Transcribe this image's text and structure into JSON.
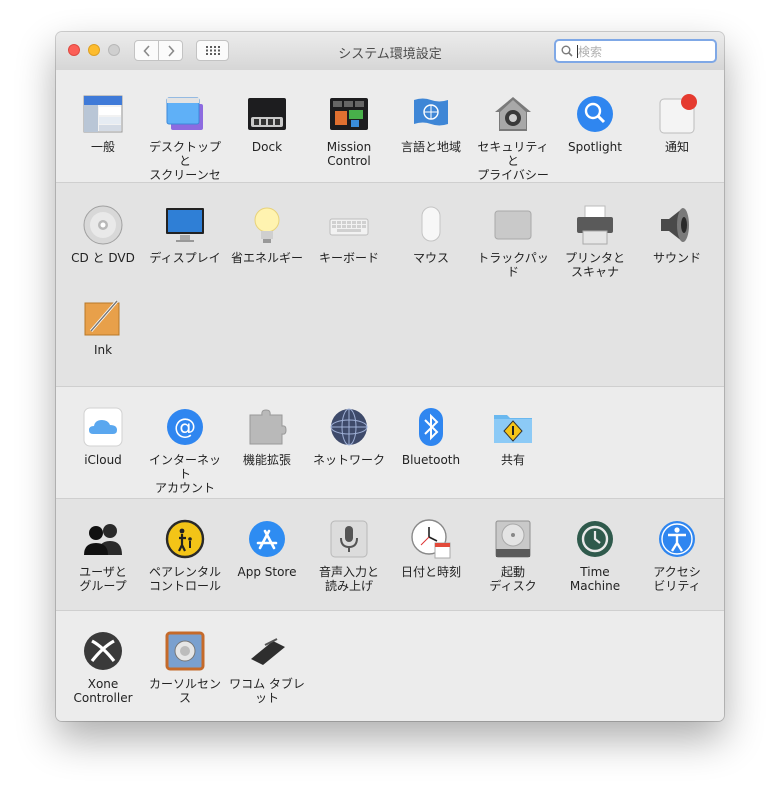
{
  "window": {
    "title": "システム環境設定"
  },
  "search": {
    "placeholder": "検索"
  },
  "sections": [
    {
      "items": [
        {
          "id": "general",
          "label": "一般"
        },
        {
          "id": "desktop",
          "label": "デスクトップと\nスクリーンセーバ"
        },
        {
          "id": "dock",
          "label": "Dock"
        },
        {
          "id": "mission",
          "label": "Mission\nControl"
        },
        {
          "id": "language",
          "label": "言語と地域"
        },
        {
          "id": "security",
          "label": "セキュリティと\nプライバシー"
        },
        {
          "id": "spotlight",
          "label": "Spotlight"
        },
        {
          "id": "notifications",
          "label": "通知"
        }
      ]
    },
    {
      "items": [
        {
          "id": "cddvd",
          "label": "CD と DVD"
        },
        {
          "id": "display",
          "label": "ディスプレイ"
        },
        {
          "id": "energy",
          "label": "省エネルギー"
        },
        {
          "id": "keyboard",
          "label": "キーボード"
        },
        {
          "id": "mouse",
          "label": "マウス"
        },
        {
          "id": "trackpad",
          "label": "トラックパッド"
        },
        {
          "id": "printers",
          "label": "プリンタと\nスキャナ"
        },
        {
          "id": "sound",
          "label": "サウンド"
        },
        {
          "id": "ink",
          "label": "Ink"
        }
      ]
    },
    {
      "items": [
        {
          "id": "icloud",
          "label": "iCloud"
        },
        {
          "id": "internet",
          "label": "インターネット\nアカウント"
        },
        {
          "id": "extensions",
          "label": "機能拡張"
        },
        {
          "id": "network",
          "label": "ネットワーク"
        },
        {
          "id": "bluetooth",
          "label": "Bluetooth"
        },
        {
          "id": "sharing",
          "label": "共有"
        }
      ]
    },
    {
      "items": [
        {
          "id": "users",
          "label": "ユーザと\nグループ"
        },
        {
          "id": "parental",
          "label": "ペアレンタル\nコントロール"
        },
        {
          "id": "appstore",
          "label": "App Store"
        },
        {
          "id": "dictation",
          "label": "音声入力と\n読み上げ"
        },
        {
          "id": "datetime",
          "label": "日付と時刻"
        },
        {
          "id": "startup",
          "label": "起動\nディスク"
        },
        {
          "id": "timemachine",
          "label": "Time\nMachine"
        },
        {
          "id": "accessibility",
          "label": "アクセシ\nビリティ"
        }
      ]
    },
    {
      "items": [
        {
          "id": "xbox",
          "label": "Xone Controller"
        },
        {
          "id": "cursor",
          "label": "カーソルセンス"
        },
        {
          "id": "wacom",
          "label": "ワコム タブレット"
        }
      ]
    }
  ],
  "icons": {
    "general": "general-icon",
    "desktop": "desktop-icon",
    "dock": "dock-icon",
    "mission": "mission-control-icon",
    "language": "un-flag-icon",
    "security": "house-lock-icon",
    "spotlight": "magnifier-icon",
    "notifications": "notification-icon"
  },
  "colors": {
    "accent": "#1a82fb",
    "close": "#fc5f57",
    "minimize": "#fdbc2e"
  }
}
